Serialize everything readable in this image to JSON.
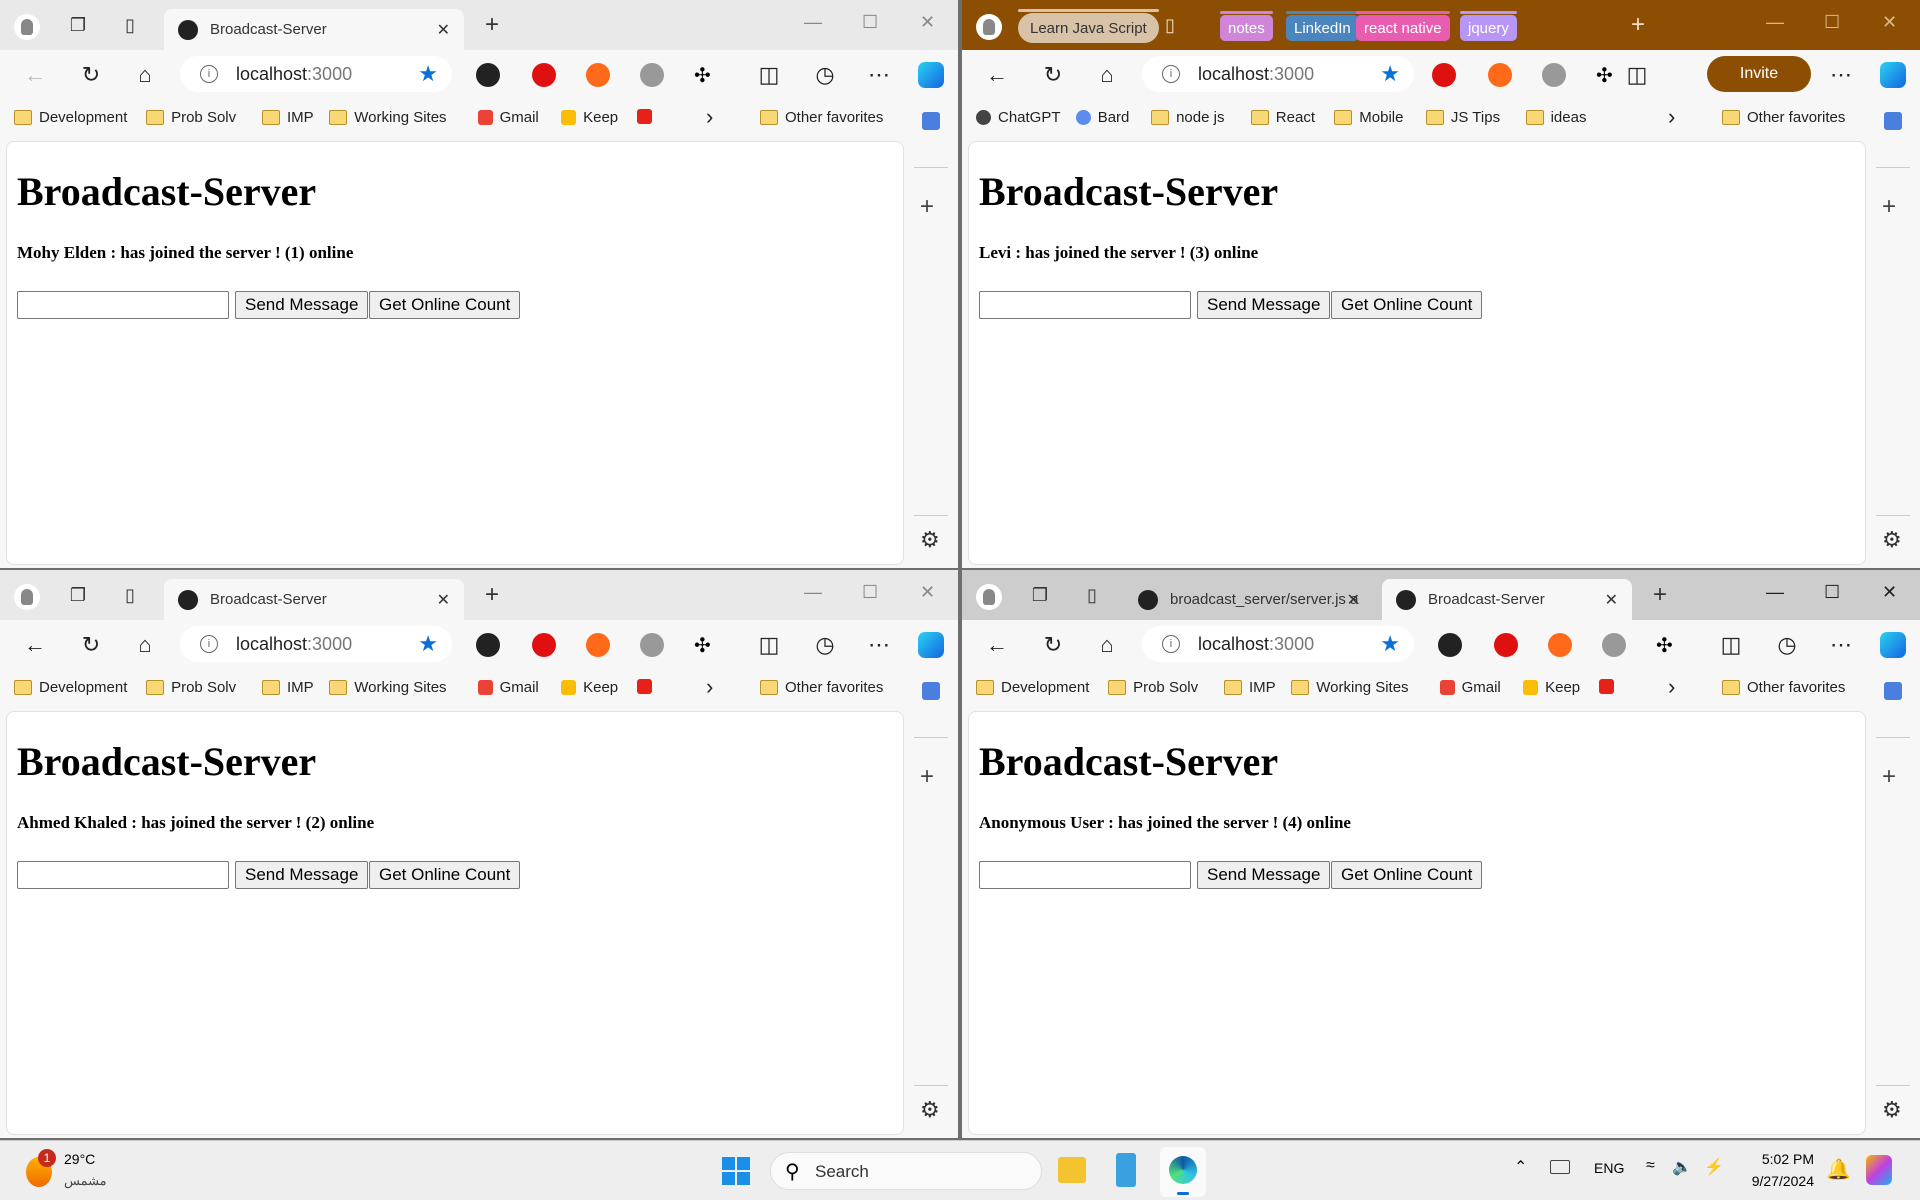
{
  "windows": [
    {
      "theme": "light",
      "tabs": [
        {
          "label": "Broadcast-Server",
          "active": true
        }
      ],
      "tab_groups": [],
      "collection": null,
      "back_enabled": false,
      "invite": null,
      "url_host": "localhost",
      "url_port": ":3000",
      "bookmarks": [
        {
          "label": "Development",
          "icon": "folder"
        },
        {
          "label": "Prob Solv",
          "icon": "folder"
        },
        {
          "label": "IMP",
          "icon": "folder"
        },
        {
          "label": "Working Sites",
          "icon": "folder"
        },
        {
          "label": "Gmail",
          "icon": "gmail"
        },
        {
          "label": "Keep",
          "icon": "keep"
        },
        {
          "label": "",
          "icon": "youtube"
        }
      ],
      "page": {
        "title": "Broadcast-Server",
        "message": "Mohy Elden : has joined the server ! (1) online",
        "input_value": "",
        "send_label": "Send Message",
        "count_label": "Get Online Count"
      }
    },
    {
      "theme": "brown",
      "tabs": [],
      "collection": "Learn Java Script",
      "tab_groups": [
        {
          "label": "notes",
          "color": "#cf86d8"
        },
        {
          "label": "LinkedIn",
          "color": "#4a86bd"
        },
        {
          "label": "react native",
          "color": "#e85db0"
        },
        {
          "label": "jquery",
          "color": "#b896f5"
        }
      ],
      "back_enabled": true,
      "invite": "Invite",
      "url_host": "localhost",
      "url_port": ":3000",
      "bookmarks": [
        {
          "label": "ChatGPT",
          "icon": "chatgpt"
        },
        {
          "label": "Bard",
          "icon": "bard"
        },
        {
          "label": "node js",
          "icon": "folder"
        },
        {
          "label": "React",
          "icon": "folder"
        },
        {
          "label": "Mobile",
          "icon": "folder"
        },
        {
          "label": "JS Tips",
          "icon": "folder"
        },
        {
          "label": "ideas",
          "icon": "folder"
        }
      ],
      "page": {
        "title": "Broadcast-Server",
        "message": "Levi : has joined the server ! (3) online",
        "input_value": "",
        "send_label": "Send Message",
        "count_label": "Get Online Count"
      }
    },
    {
      "theme": "light",
      "tabs": [
        {
          "label": "Broadcast-Server",
          "active": true
        }
      ],
      "tab_groups": [],
      "collection": null,
      "back_enabled": true,
      "invite": null,
      "url_host": "localhost",
      "url_port": ":3000",
      "bookmarks": [
        {
          "label": "Development",
          "icon": "folder"
        },
        {
          "label": "Prob Solv",
          "icon": "folder"
        },
        {
          "label": "IMP",
          "icon": "folder"
        },
        {
          "label": "Working Sites",
          "icon": "folder"
        },
        {
          "label": "Gmail",
          "icon": "gmail"
        },
        {
          "label": "Keep",
          "icon": "keep"
        },
        {
          "label": "",
          "icon": "youtube"
        }
      ],
      "page": {
        "title": "Broadcast-Server",
        "message": "Ahmed Khaled : has joined the server ! (2) online",
        "input_value": "",
        "send_label": "Send Message",
        "count_label": "Get Online Count"
      }
    },
    {
      "theme": "gray",
      "tabs": [
        {
          "label": "broadcast_server/server.js a",
          "active": false
        },
        {
          "label": "Broadcast-Server",
          "active": true
        }
      ],
      "tab_groups": [],
      "collection": null,
      "back_enabled": true,
      "invite": null,
      "url_host": "localhost",
      "url_port": ":3000",
      "bookmarks": [
        {
          "label": "Development",
          "icon": "folder"
        },
        {
          "label": "Prob Solv",
          "icon": "folder"
        },
        {
          "label": "IMP",
          "icon": "folder"
        },
        {
          "label": "Working Sites",
          "icon": "folder"
        },
        {
          "label": "Gmail",
          "icon": "gmail"
        },
        {
          "label": "Keep",
          "icon": "keep"
        },
        {
          "label": "",
          "icon": "youtube"
        }
      ],
      "page": {
        "title": "Broadcast-Server",
        "message": "Anonymous User : has joined the server ! (4) online",
        "input_value": "",
        "send_label": "Send Message",
        "count_label": "Get Online Count"
      }
    }
  ],
  "other_favorites": "Other favorites",
  "taskbar": {
    "weather_temp": "29°C",
    "weather_desc": "مشمس",
    "weather_badge": "1",
    "search_placeholder": "Search",
    "language": "ENG",
    "time": "5:02 PM",
    "date": "9/27/2024"
  }
}
